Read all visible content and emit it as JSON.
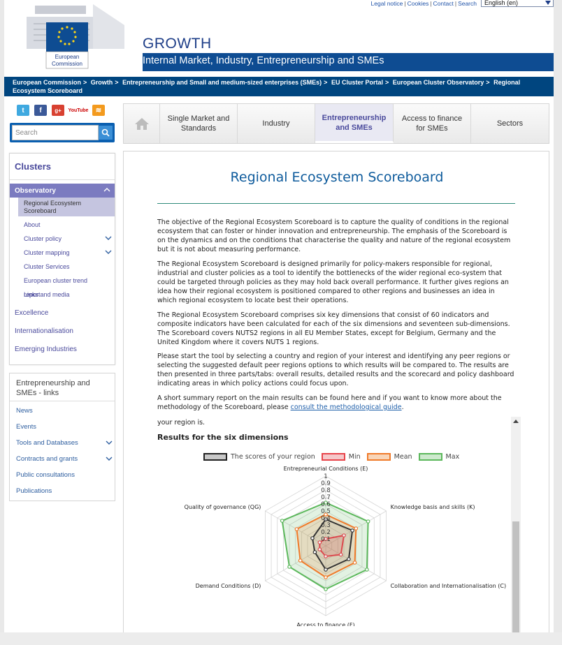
{
  "utility": {
    "legal": "Legal notice",
    "cookies": "Cookies",
    "contact": "Contact",
    "search": "Search",
    "language": "English (en)"
  },
  "header": {
    "logo_text_1": "European",
    "logo_text_2": "Commission",
    "site": "GROWTH",
    "subtitle": "Internal Market, Industry, Entrepreneurship and SMEs"
  },
  "breadcrumb": [
    "European Commission",
    "Growth",
    "Entrepreneurship and Small and medium-sized enterprises (SMEs)",
    "EU Cluster Portal",
    "European Cluster Observatory",
    "Regional Ecosystem Scoreboard"
  ],
  "search": {
    "placeholder": "Search"
  },
  "left_nav": {
    "title": "Clusters",
    "observatory": "Observatory",
    "selected": "Regional Ecosystem Scoreboard",
    "items": [
      "About",
      "Cluster policy",
      "Cluster mapping",
      "Cluster Services",
      "European cluster trend report",
      "Links and media"
    ],
    "top_items": [
      "Excellence",
      "Internationalisation",
      "Emerging Industries"
    ]
  },
  "links_panel": {
    "title": "Entrepreneurship and SMEs - links",
    "items": [
      "News",
      "Events",
      "Tools and Databases",
      "Contracts and grants",
      "Public consultations",
      "Publications"
    ]
  },
  "nav_tabs": {
    "tabs": [
      "Single Market and Standards",
      "Industry",
      "Entrepreneurship and SMEs",
      "Access to finance for SMEs",
      "Sectors"
    ]
  },
  "main": {
    "title": "Regional Ecosystem Scoreboard",
    "p1": "The objective of the Regional Ecosystem Scoreboard is to capture the quality of conditions in the regional ecosystem that can foster or hinder innovation and entrepreneurship. The emphasis of the Scoreboard is on the dynamics and on the conditions that characterise the quality and nature of the regional ecosystem but it is not about measuring performance.",
    "p2": "The Regional Ecosystem Scoreboard is designed primarily for policy-makers responsible for regional, industrial and cluster policies as a tool to identify the bottlenecks of the wider regional eco-system that could be targeted through policies as they may hold back overall performance. It further gives regions an idea how their regional ecosystem is positioned compared to other regions and businesses an idea in which regional ecosystem to locate best their operations.",
    "p3": "The Regional Ecosystem Scoreboard comprises six key dimensions that consist of 60 indicators and composite indicators have been calculated for each of the six dimensions and seventeen sub-dimensions. The Scoreboard covers NUTS2 regions in all EU Member States, except for Belgium, Germany and the United Kingdom where it covers NUTS 1 regions.",
    "p4": "Please start the tool by selecting a country and region of your interest and identifying any peer regions or selecting the suggested default peer regions options to which results will be compared to. The results are then presented in three parts/tabs: overall results, detailed results and the scorecard and policy dashboard indicating areas in which policy actions could focus upon.",
    "p5_text": "A short summary report on the main results can be found here and if you want to know more about the methodology of the Scoreboard, please ",
    "p5_link": "consult the methodological guide",
    "p5_end": ".",
    "region_text": "your region is.",
    "results_title": "Results for the six dimensions"
  },
  "chart_data": {
    "type": "radar",
    "legend": [
      "The scores of your region",
      "Min",
      "Mean",
      "Max"
    ],
    "axes": [
      "Entrepreneurial Conditions (E)",
      "Knowledge basis and skills (K)",
      "Collaboration and Internationalisation (C)",
      "Access to finance (F)",
      "Demand Conditions (D)",
      "Quality of governance (QG)"
    ],
    "ticks": [
      "1",
      "0.9",
      "0.8",
      "0.7",
      "0.6",
      "0.5",
      "0.4",
      "0.3",
      "0.2",
      "0.1"
    ],
    "range": [
      0,
      1
    ],
    "series": [
      {
        "name": "The scores of your region",
        "color": "#333333",
        "values": [
          0.38,
          0.44,
          0.38,
          0.34,
          0.18,
          0.22
        ]
      },
      {
        "name": "Min",
        "color": "#e8444a",
        "values": [
          0.1,
          0.3,
          0.25,
          0.15,
          0.1,
          0.1
        ]
      },
      {
        "name": "Mean",
        "color": "#f07a2a",
        "values": [
          0.45,
          0.5,
          0.48,
          0.45,
          0.42,
          0.48
        ]
      },
      {
        "name": "Max",
        "color": "#5cb85c",
        "values": [
          0.62,
          0.7,
          0.68,
          0.62,
          0.6,
          0.72
        ]
      }
    ]
  }
}
